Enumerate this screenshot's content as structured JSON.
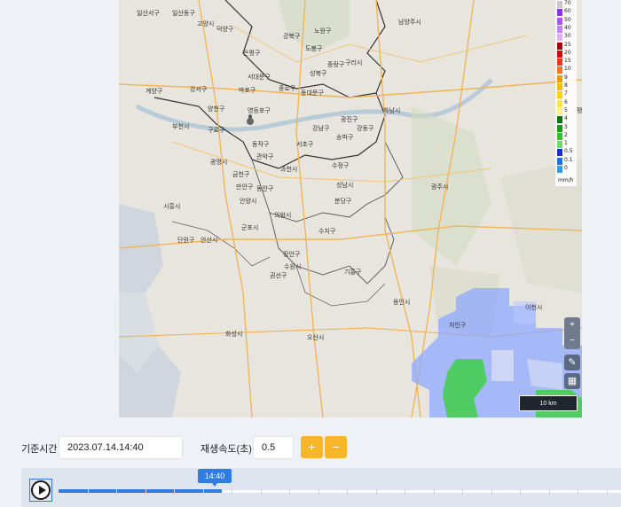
{
  "map": {
    "places": [
      {
        "name": "일산서구"
      },
      {
        "name": "일산동구"
      },
      {
        "name": "고양시"
      },
      {
        "name": "덕양구"
      },
      {
        "name": "남양주시"
      },
      {
        "name": "강북구"
      },
      {
        "name": "노원구"
      },
      {
        "name": "은평구"
      },
      {
        "name": "도봉구"
      },
      {
        "name": "성북구"
      },
      {
        "name": "중랑구"
      },
      {
        "name": "구리시"
      },
      {
        "name": "마포구"
      },
      {
        "name": "서대문구"
      },
      {
        "name": "종로구"
      },
      {
        "name": "동대문구"
      },
      {
        "name": "강서구"
      },
      {
        "name": "양천구"
      },
      {
        "name": "영등포구"
      },
      {
        "name": "광진구"
      },
      {
        "name": "하남시"
      },
      {
        "name": "계양구"
      },
      {
        "name": "부천시"
      },
      {
        "name": "구로구"
      },
      {
        "name": "동작구"
      },
      {
        "name": "서초구"
      },
      {
        "name": "강남구"
      },
      {
        "name": "송파구"
      },
      {
        "name": "강동구"
      },
      {
        "name": "광명시"
      },
      {
        "name": "금천구"
      },
      {
        "name": "과천시"
      },
      {
        "name": "관악구"
      },
      {
        "name": "성남시"
      },
      {
        "name": "수정구"
      },
      {
        "name": "분당구"
      },
      {
        "name": "광주시"
      },
      {
        "name": "시흥시"
      },
      {
        "name": "안양시"
      },
      {
        "name": "만안구"
      },
      {
        "name": "동안구"
      },
      {
        "name": "의왕시"
      },
      {
        "name": "군포시"
      },
      {
        "name": "안산시"
      },
      {
        "name": "단원구"
      },
      {
        "name": "수지구"
      },
      {
        "name": "수원시"
      },
      {
        "name": "장안구"
      },
      {
        "name": "기흥구"
      },
      {
        "name": "권선구"
      },
      {
        "name": "용인시"
      },
      {
        "name": "처인구"
      },
      {
        "name": "이천시"
      },
      {
        "name": "화성시"
      },
      {
        "name": "오산시"
      }
    ],
    "legend": {
      "levels": [
        "70",
        "60",
        "50",
        "40",
        "30",
        "25",
        "20",
        "15",
        "10",
        "9",
        "8",
        "7",
        "6",
        "5",
        "4",
        "3",
        "2",
        "1",
        "0.5",
        "0.1",
        "0"
      ],
      "colors": [
        "#c8c8c8",
        "#8f30f0",
        "#b050ff",
        "#c980ff",
        "#e0b0ff",
        "#b00000",
        "#d80000",
        "#ff3020",
        "#ff7020",
        "#f09a00",
        "#f0c000",
        "#ffd400",
        "#ffe34d",
        "#fff08c",
        "#007a00",
        "#1a9a1a",
        "#33c033",
        "#66dd66",
        "#1a2fd6",
        "#1a6ef0",
        "#2e9cf5"
      ],
      "unit": "mm/h"
    },
    "side_label": "평",
    "scale": "10 km",
    "zoom_in": "+",
    "zoom_out": "−"
  },
  "controls": {
    "base_time_label": "기준시간",
    "base_time_value": "2023.07.14.14:40",
    "speed_label": "재생속도(초)",
    "speed_value": "0.5",
    "plus": "+",
    "minus": "−"
  },
  "timeline": {
    "current": "14:40",
    "progress": 0.29,
    "ticks": 20
  }
}
